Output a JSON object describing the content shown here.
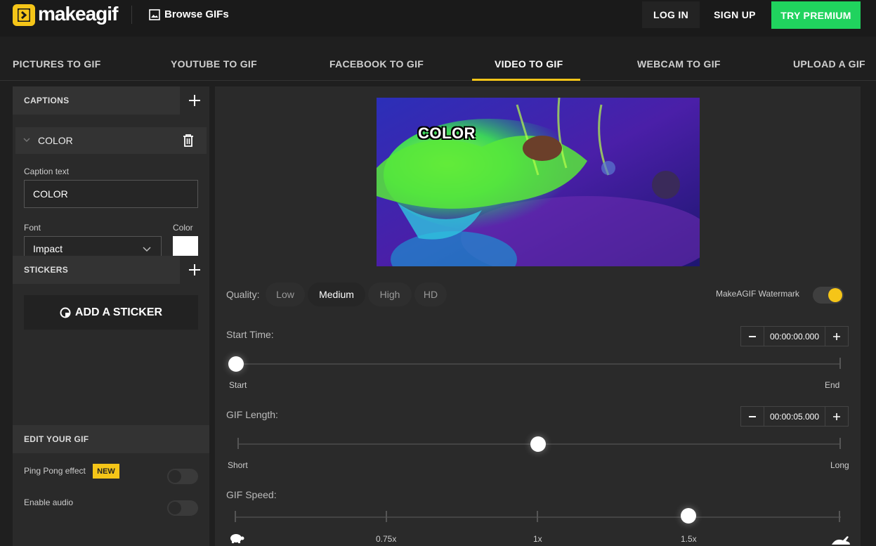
{
  "header": {
    "logo_text": "makeagif",
    "browse_label": "Browse GIFs",
    "login_label": "LOG IN",
    "signup_label": "SIGN UP",
    "premium_label": "TRY PREMIUM",
    "brand_color": "#f5c518",
    "premium_color": "#20d35e"
  },
  "tabs": [
    {
      "label": "PICTURES TO GIF"
    },
    {
      "label": "YOUTUBE TO GIF"
    },
    {
      "label": "FACEBOOK TO GIF"
    },
    {
      "label": "VIDEO TO GIF",
      "active": true
    },
    {
      "label": "WEBCAM TO GIF"
    },
    {
      "label": "UPLOAD A GIF"
    }
  ],
  "sidebar": {
    "captions_title": "CAPTIONS",
    "caption_item_name": "COLOR",
    "caption_text_label": "Caption text",
    "caption_text_value": "COLOR",
    "font_label": "Font",
    "font_value": "Impact",
    "color_label": "Color",
    "color_value": "#ffffff",
    "stickers_title": "STICKERS",
    "add_sticker_label": "ADD A STICKER",
    "edit_title": "EDIT YOUR GIF",
    "ping_pong_label": "Ping Pong effect",
    "new_badge": "NEW",
    "enable_audio_label": "Enable audio"
  },
  "main": {
    "preview_caption": "COLOR",
    "quality_label": "Quality:",
    "quality_options": [
      "Low",
      "Medium",
      "High",
      "HD"
    ],
    "quality_selected": "Medium",
    "watermark_label": "MakeAGIF Watermark",
    "watermark_on": true,
    "start_time_label": "Start Time:",
    "start_time_value": "00:00:00.000",
    "start_label": "Start",
    "end_label": "End",
    "start_fraction": 0,
    "gif_length_label": "GIF Length:",
    "gif_length_value": "00:00:05.000",
    "short_label": "Short",
    "long_label": "Long",
    "length_fraction": 0.5,
    "gif_speed_label": "GIF Speed:",
    "speed_ticks": [
      "0.75x",
      "1x",
      "1.5x"
    ],
    "speed_selected": "1.5x"
  }
}
